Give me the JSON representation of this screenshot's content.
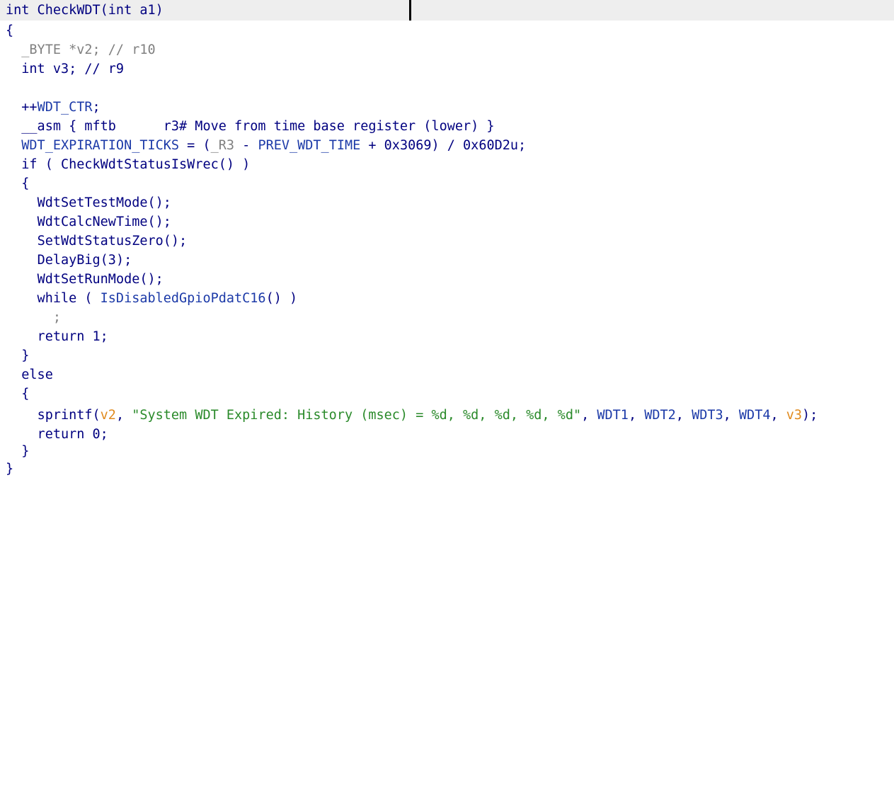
{
  "editor": {
    "lines": [
      [
        "int CheckWDT(int a1)"
      ],
      [
        "{"
      ],
      [
        "  ",
        "_BYTE *v2; // r10"
      ],
      [
        "  int v3; // r9"
      ],
      [
        ""
      ],
      [
        "  ++",
        "WDT_CTR",
        ";"
      ],
      [
        "  __asm { mftb      r3# Move from time base register (lower) }"
      ],
      [
        "  ",
        "WDT_EXPIRATION_TICKS",
        " = (",
        "_R3",
        " - ",
        "PREV_WDT_TIME",
        " + 0x3069) / 0x60D2u;"
      ],
      [
        "  if ( ",
        "CheckWdtStatusIsWrec",
        "() )"
      ],
      [
        "  {"
      ],
      [
        "    ",
        "WdtSetTestMode",
        "();"
      ],
      [
        "    ",
        "WdtCalcNewTime",
        "();"
      ],
      [
        "    ",
        "SetWdtStatusZero",
        "();"
      ],
      [
        "    ",
        "DelayBig",
        "(3);"
      ],
      [
        "    ",
        "WdtSetRunMode",
        "();"
      ],
      [
        "    while ( ",
        "IsDisabledGpioPdatC16",
        "() )"
      ],
      [
        "      ;"
      ],
      [
        "    return 1;"
      ],
      [
        "  }"
      ],
      [
        "  else"
      ],
      [
        "  {"
      ],
      [
        "    ",
        "sprintf",
        "(",
        "v2",
        ", ",
        "\"System WDT Expired: History (msec) = %d, %d, %d, %d, %d\"",
        ", ",
        "WDT1",
        ", ",
        "WDT2",
        ", ",
        "WDT3",
        ", ",
        "WDT4",
        ", ",
        "v3",
        ");"
      ],
      [
        "    return 0;"
      ],
      [
        "  }"
      ],
      [
        "}"
      ]
    ]
  }
}
